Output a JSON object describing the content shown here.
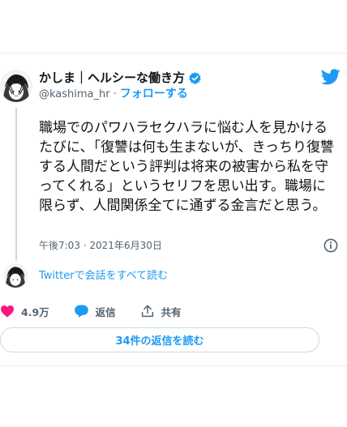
{
  "author": {
    "display_name": "かしま｜ヘルシーな働き方",
    "handle": "@kashima_hr",
    "separator": "·",
    "follow_label": "フォローする",
    "verified_icon": "verified-badge-icon",
    "avatar_icon": "profile-avatar"
  },
  "tweet": {
    "text": "職場でのパワハラセクハラに悩む人を見かけるたびに、「復讐は何も生まないが、きっちり復讐する人間だという評判は将来の被害から私を守ってくれる」というセリフを思い出す。職場に限らず、人間関係全てに通ずる金言だと思う。",
    "timestamp": "午後7:03 · 2021年6月30日",
    "conversation_link": "Twitterで会話をすべて読む"
  },
  "actions": {
    "like_count": "4.9万",
    "reply_label": "返信",
    "share_label": "共有"
  },
  "read_replies_label": "34件の返信を読む",
  "colors": {
    "accent": "#1d9bf0",
    "like": "#f91880",
    "secondary_text": "#536471",
    "border": "#cfd9de"
  },
  "icons": {
    "brand": "twitter-bird-icon",
    "info": "info-icon",
    "like": "heart-icon",
    "reply": "speech-bubble-icon",
    "share": "share-icon"
  }
}
